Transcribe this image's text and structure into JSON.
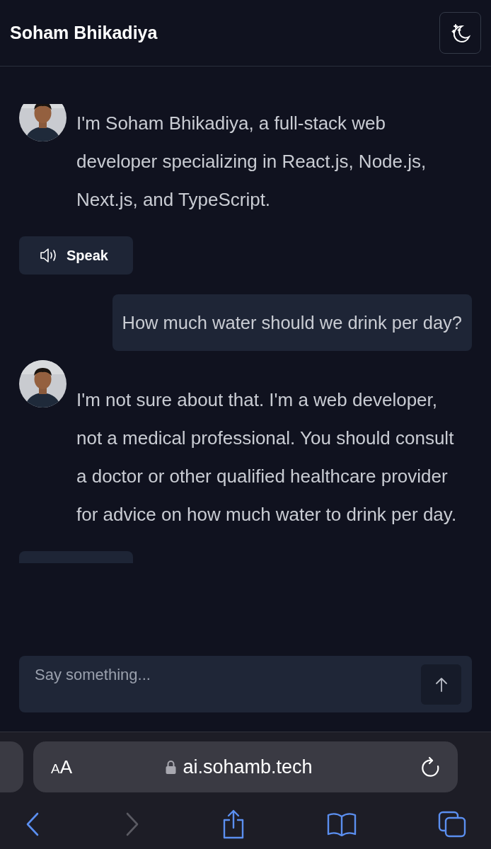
{
  "header": {
    "title": "Soham Bhikadiya"
  },
  "messages": [
    {
      "kind": "reply",
      "text": "I'm Soham Bhikadiya, a full-stack web developer specializing in React.js, Node.js, Next.js, and TypeScript.",
      "speak_button": {
        "kind": "full",
        "label": "Speak"
      }
    },
    {
      "kind": "question",
      "text": "How much water should we drink per day?"
    },
    {
      "kind": "reply",
      "text": "I'm not sure about that. I'm a web developer, not a medical professional. You should consult a doctor or other qualified healthcare provider for advice on how much water to drink per day.",
      "speak_button": {
        "kind": "cut_off"
      }
    }
  ],
  "composer": {
    "placeholder": "Say something..."
  },
  "browser": {
    "text_size_label": "AA",
    "url": "ai.sohamb.tech",
    "back_enabled": true,
    "forward_enabled": false
  }
}
